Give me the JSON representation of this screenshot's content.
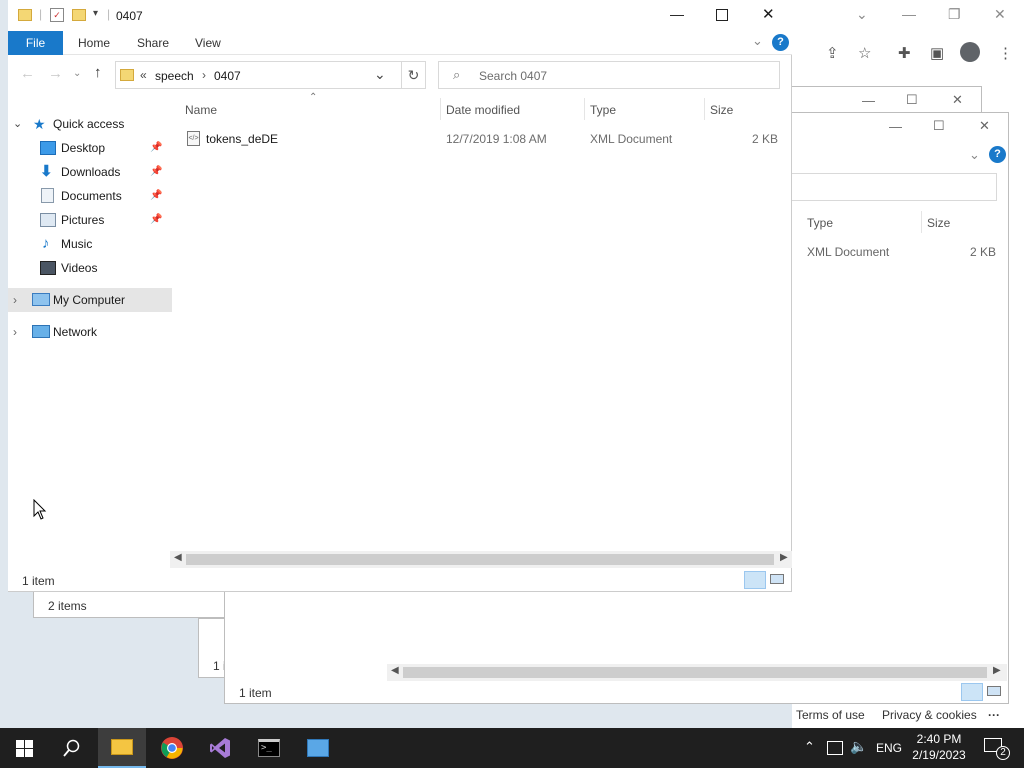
{
  "main": {
    "title": "0407",
    "ribbon": {
      "file": "File",
      "home": "Home",
      "share": "Share",
      "view": "View"
    },
    "address": {
      "sep": "«",
      "parts": [
        "speech",
        "0407"
      ]
    },
    "search_placeholder": "Search 0407",
    "nav": {
      "quick_access": "Quick access",
      "desktop": "Desktop",
      "downloads": "Downloads",
      "documents": "Documents",
      "pictures": "Pictures",
      "music": "Music",
      "videos": "Videos",
      "my_computer": "My Computer",
      "network": "Network"
    },
    "columns": {
      "name": "Name",
      "date": "Date modified",
      "type": "Type",
      "size": "Size"
    },
    "files": [
      {
        "name": "tokens_deDE",
        "date": "12/7/2019 1:08 AM",
        "type": "XML Document",
        "size": "2 KB"
      }
    ],
    "status": "1 item"
  },
  "back_window_1": {
    "columns": {
      "type": "Type",
      "size": "Size"
    },
    "file": {
      "type": "XML Document",
      "size": "2 KB"
    },
    "status": "1 item"
  },
  "back_window_2": {
    "status": "2 items"
  },
  "back_window_3": {
    "status_partial": "1 i"
  },
  "chrome": {
    "terms": "Terms of use",
    "privacy": "Privacy & cookies",
    "more": "···"
  },
  "taskbar": {
    "lang": "ENG",
    "time": "2:40 PM",
    "date": "2/19/2023",
    "notifications": "2"
  },
  "colors": {
    "accent": "#1979ca",
    "taskbar": "#1f1f1f",
    "selected": "#e5e5e5"
  }
}
